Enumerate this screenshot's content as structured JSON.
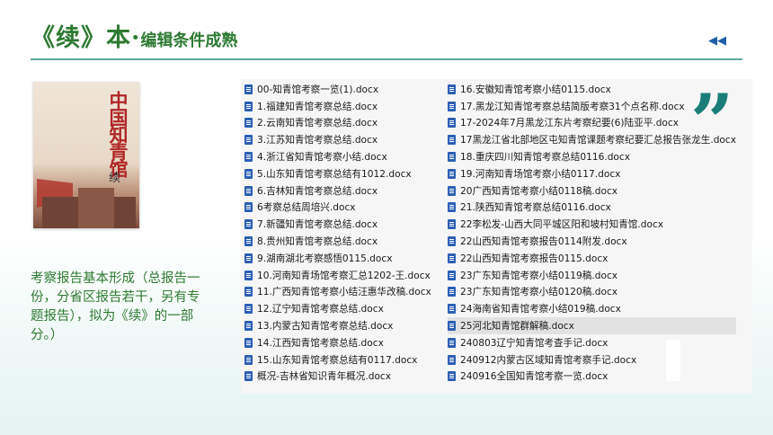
{
  "header": {
    "title_main": "《续》本·",
    "title_sub": "编辑条件成熟",
    "nav_icon": "double-left-arrow-icon"
  },
  "book_cover": {
    "title_vertical": "中国知青馆",
    "subtitle": "续"
  },
  "description": "考察报告基本形成（总报告一份，分省区报告若干，另有专题报告），拟为《续》的一部分。）",
  "colors": {
    "accent_green": "#2e7a32",
    "quote_teal": "#1a7d78",
    "nav_blue": "#1f5fa8"
  },
  "files_left": [
    "00-知青馆考察一览(1).docx",
    "1.福建知青馆考察总结.docx",
    "2.云南知青馆考察总结.docx",
    "3.江苏知青馆考察总结.docx",
    "4.浙江省知青馆考察小结.docx",
    "5.山东知青馆考察总结有1012.docx",
    "6.吉林知青馆考察总结.docx",
    "6考察总结周培兴.docx",
    "7.新疆知青馆考察总结.docx",
    "8.贵州知青馆考察总结.docx",
    "9.湖南湖北考察感悟0115.docx",
    "10.河南知青场馆考察汇总1202-王.docx",
    "11.广西知青馆考察小结汪惠华改稿.docx",
    "12.辽宁知青馆考察总结.docx",
    "13.内蒙古知青馆考察总结.docx",
    "14.江西知青馆考察总结.docx",
    "15.山东知青馆考察总结有0117.docx",
    "概况-吉林省知识青年概况.docx"
  ],
  "files_right": [
    "16.安徽知青馆考察小结0115.docx",
    "17.黑龙江知青馆考察总结简版考察31个点名称.docx",
    "17-2024年7月黑龙江东片考察纪要(6)陆亚平.docx",
    "17黑龙江省北部地区屯知青馆课题考察纪要汇总报告张龙生.docx",
    "18.重庆四川知青馆考察总结0116.docx",
    "19.河南知青场馆考察小结0117.docx",
    "20广西知青馆考察小结0118稿.docx",
    "21.陕西知青馆考察总结0116.docx",
    "22李松发-山西大同平城区阳和坡村知青馆.docx",
    "22山西知青馆考察报告0114附发.docx",
    "22山西知青馆考察报告0115.docx",
    "23广东知青馆考察小结0119稿.docx",
    "23广东知青馆考察小结0120稿.docx",
    "24海南省知青馆考察小结019稿.docx",
    "25河北知青馆群解稿.docx",
    "240803辽宁知青馆考查手记.docx",
    "240912内蒙古区域知青馆考察手记.docx",
    "240916全国知青馆考察一览.docx"
  ],
  "highlighted_right_index": 14,
  "quote_mark": "”"
}
